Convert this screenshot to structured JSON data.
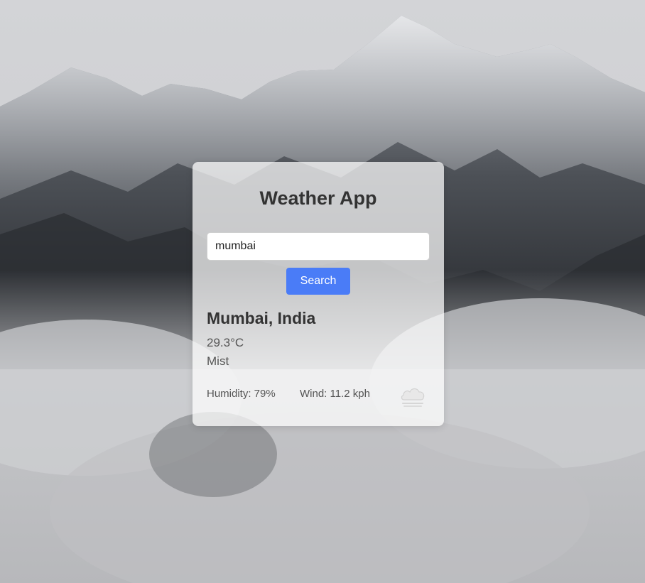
{
  "app": {
    "title": "Weather App"
  },
  "search": {
    "value": "mumbai",
    "button_label": "Search"
  },
  "weather": {
    "location": "Mumbai, India",
    "temperature": "29.3°C",
    "condition": "Mist",
    "humidity": "Humidity: 79%",
    "wind": "Wind: 11.2 kph",
    "icon": "mist-cloud-icon"
  },
  "colors": {
    "accent": "#4a7cf7",
    "title_text": "#333333",
    "body_text": "#555555"
  }
}
